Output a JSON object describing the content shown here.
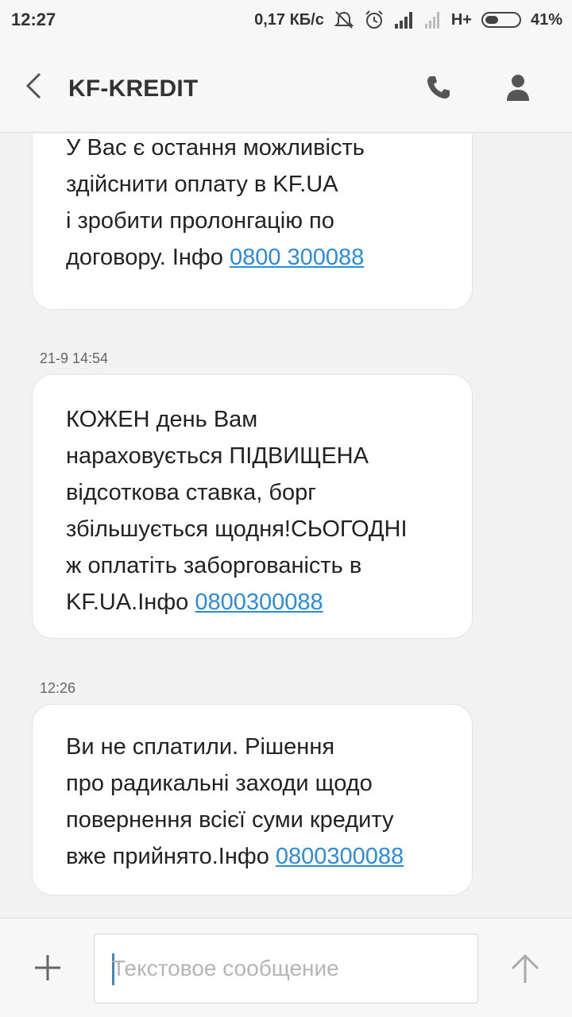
{
  "status_bar": {
    "time": "12:27",
    "network_speed": "0,17 КБ/с",
    "network_type": "H+",
    "battery_percent": "41%",
    "battery_level": 0.41,
    "icons": [
      "mute-icon",
      "alarm-icon",
      "signal-icon",
      "signal-icon-2"
    ]
  },
  "header": {
    "title": "KF-KREDIT",
    "icons": [
      "back-arrow-icon",
      "phone-icon",
      "contact-icon"
    ]
  },
  "messages": [
    {
      "timestamp": "",
      "text": "У Вас є остання можливість\nздійснити оплату в KF.UA\nі зробити пролонгацію по\nдоговору. Інфо ",
      "link": "0800 300088"
    },
    {
      "timestamp": "21-9 14:54",
      "text": "КОЖЕН день Вам\nнараховується ПІДВИЩЕНА\nвідсоткова ставка, борг\nзбільшується щодня!СЬОГОДНІ\nж оплатіть заборгованість в\nKF.UA.Інфо ",
      "link": "0800300088"
    },
    {
      "timestamp": "12:26",
      "text": "Ви не сплатили. Рішення\nпро радикальні заходи щодо\nповернення всієї суми кредиту\nвже прийнято.Інфо ",
      "link": "0800300088"
    }
  ],
  "composer": {
    "placeholder": "Текстовое сообщение",
    "value": "",
    "icons": [
      "plus-icon",
      "send-arrow-icon"
    ]
  },
  "colors": {
    "link": "#2a8cdb",
    "background": "#f2f2f2",
    "bubble": "#ffffff"
  }
}
